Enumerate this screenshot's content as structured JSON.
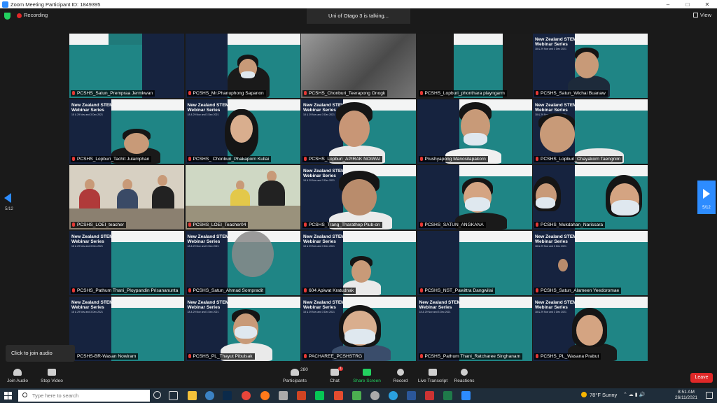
{
  "window": {
    "title": "Zoom Meeting Participant ID: 1849395"
  },
  "topbar": {
    "recording_label": "Recording",
    "talking": "Uni of Otago 3 is talking...",
    "view_label": "View"
  },
  "banner": {
    "title": "New Zealand STEM Webinar Series",
    "subtitle": "18 & 29 Nov and 3 Dec 2021"
  },
  "participants": [
    "PCSHS_Satun_Prempraa Jermkwan",
    "PCSHS_Mr.Phanuphong Sapanon",
    "PCSHS_Chonburi_Teerapong Onogk",
    "PCSHS_Lopburi_phonthara playngarm",
    "PCSHS_Satun_Wichai Buanaw",
    "PCSHS_Lopburi_Tachit Julamphan",
    "PCSHS_ Chonburi_Phakaporn Kullai",
    "PCSHS_Lopburi_APIRAK NOIWAI",
    "Prushyapong Manosilapakorn",
    "PCSHS_Lopburi_Chayakorn Taengnim",
    "PCSHS_LOEI_teacher",
    "PCSHS_LOEI_Teacher04",
    "PCSHS_Trang_Tharathep Plub-on",
    "PCSHS_SATUN_ANGKANA",
    "PCSHS_Mukdahan_Narissara",
    "PCSHS_Pathum Thani_Ploypandin Prisananunta",
    "PCSHS_Satun_Ahmad Sornpradit",
    "604 Apiwat Kratudnak",
    "PCSHS_NST_Pawittra Dangwilai",
    "PCSHS_Satun_Alameen Yeedoromae",
    "PCSHS-BR-Wasan Nowiram",
    "PCSHS_PL_Thayut Pibulsak",
    "PACHAREE_PCSHSTRG",
    "PCSHS_Pathum Thani_Ratcharee Singhanam",
    "PCSHS_PL_Wasana Prabut"
  ],
  "nav": {
    "page_left": "5/12",
    "page_right": "5/12"
  },
  "tooltip": {
    "audio": "Click to join audio"
  },
  "toolbar": {
    "join_audio": "Join Audio",
    "stop_video": "Stop Video",
    "participants": "Participants",
    "participants_count": "280",
    "chat": "Chat",
    "chat_badge": "1",
    "share_screen": "Share Screen",
    "record": "Record",
    "live_transcript": "Live Transcript",
    "reactions": "Reactions",
    "leave": "Leave"
  },
  "taskbar": {
    "search_placeholder": "Type here to search",
    "weather_temp": "78°F",
    "weather_text": "Sunny",
    "time": "8:51 AM",
    "date": "26/11/2021"
  },
  "colors": {
    "zoom_blue": "#2d8cff",
    "share_green": "#23d160",
    "leave_red": "#e02828",
    "banner_navy": "#16233f",
    "banner_teal": "#1f8585"
  }
}
